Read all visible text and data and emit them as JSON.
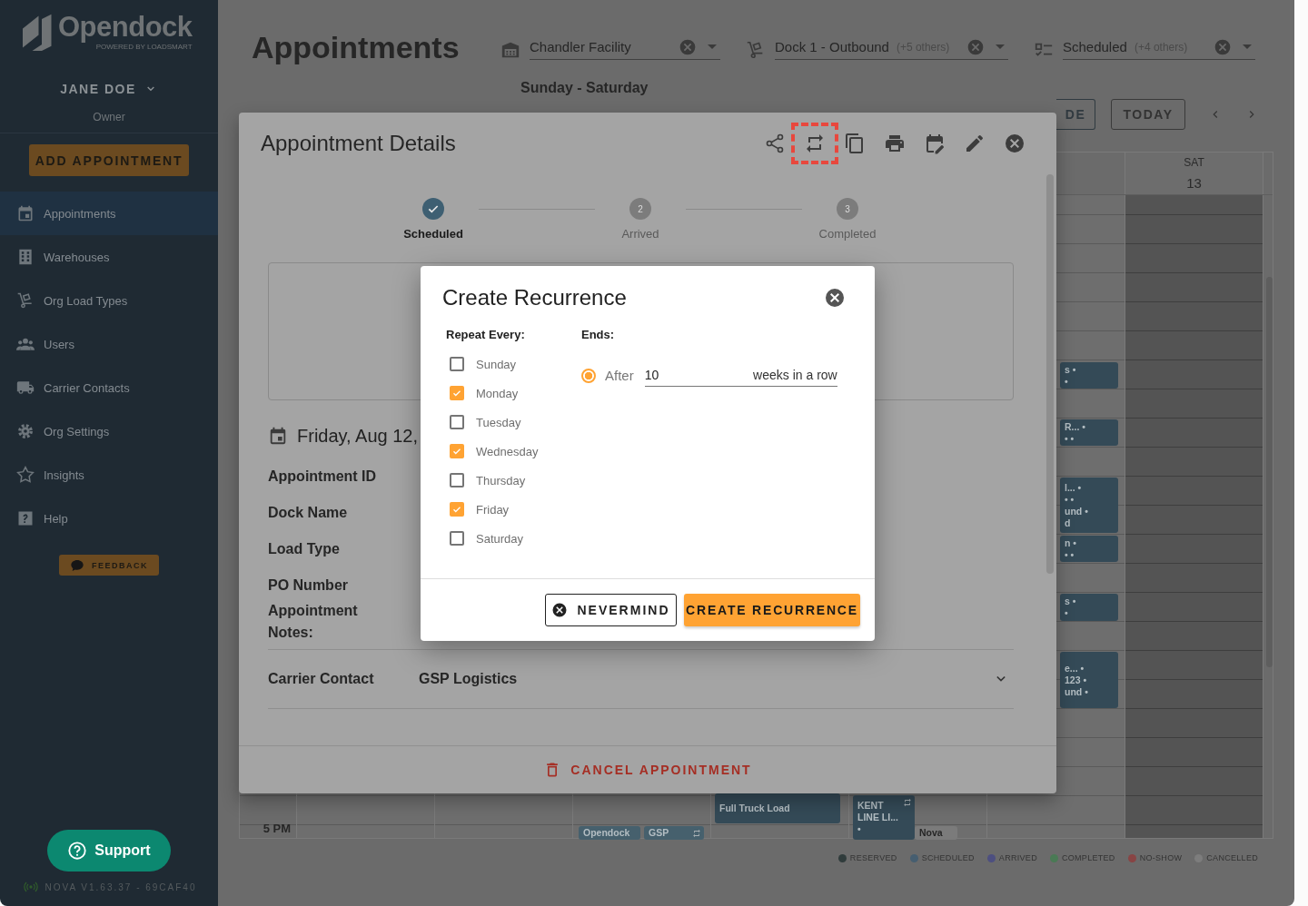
{
  "sidebar": {
    "logo": {
      "name": "Opendock",
      "tagline": "POWERED BY LOADSMART"
    },
    "user": {
      "name": "JANE DOE",
      "role": "Owner"
    },
    "add_button": "ADD APPOINTMENT",
    "nav": [
      {
        "label": "Appointments",
        "kind": "calendar",
        "selected": true
      },
      {
        "label": "Warehouses",
        "kind": "building",
        "selected": false
      },
      {
        "label": "Org Load Types",
        "kind": "dolly",
        "selected": false
      },
      {
        "label": "Users",
        "kind": "users",
        "selected": false
      },
      {
        "label": "Carrier Contacts",
        "kind": "truck",
        "selected": false
      },
      {
        "label": "Org Settings",
        "kind": "gear",
        "selected": false
      },
      {
        "label": "Insights",
        "kind": "insights",
        "selected": false
      },
      {
        "label": "Help",
        "kind": "help",
        "selected": false
      }
    ],
    "feedback": "FEEDBACK",
    "support": "Support",
    "version": "NOVA V1.63.37 - 69CAF40"
  },
  "header": {
    "title": "Appointments",
    "filters": [
      {
        "kind": "warehouse",
        "value": "Chandler Facility"
      },
      {
        "kind": "dolly",
        "value": "Dock 1 - Outbound",
        "extra": "(+5 others)"
      },
      {
        "kind": "checklist",
        "value": "Scheduled",
        "extra": "(+4 others)"
      }
    ]
  },
  "calendar": {
    "range": "Sunday - Saturday",
    "mode_button": "DE",
    "today_button": "TODAY",
    "columns": [
      {
        "day": "SAT",
        "date": "13"
      }
    ],
    "time_labels": [
      "5 PM"
    ],
    "events": [
      {
        "lines": [
          "s •",
          "•"
        ],
        "color": "#344a57"
      },
      {
        "lines": [
          "R... •",
          "•  •"
        ],
        "color": "#344a57"
      },
      {
        "lines": [
          "l... •",
          "•  •",
          "und •",
          "d"
        ],
        "color": "#344a57"
      },
      {
        "lines": [
          "n •",
          "•  •"
        ],
        "color": "#344a57"
      },
      {
        "lines": [
          "s •",
          "•"
        ],
        "color": "#344a57"
      },
      {
        "lines": [
          "e... •",
          "123 •",
          "und •"
        ],
        "color": "#344a57"
      },
      {
        "lines": [
          "Full Truck Load"
        ],
        "color": "#344a57"
      },
      {
        "lines": [
          "KENT",
          "LINE LI...",
          "•"
        ],
        "color": "#344a57",
        "recurring": true
      },
      {
        "lines": [
          "Opendock"
        ],
        "color": "#46606d"
      },
      {
        "lines": [
          "GSP"
        ],
        "color": "#46606d",
        "recurring": true
      },
      {
        "lines": [
          "Nova"
        ],
        "color": "#7b7b7b"
      }
    ],
    "legend": [
      {
        "label": "RESERVED",
        "color": "#303c3c"
      },
      {
        "label": "SCHEDULED",
        "color": "#465e70"
      },
      {
        "label": "ARRIVED",
        "color": "#4d4f80"
      },
      {
        "label": "COMPLETED",
        "color": "#4a7a55"
      },
      {
        "label": "NO-SHOW",
        "color": "#884444"
      },
      {
        "label": "CANCELLED",
        "color": "#7d7d7d"
      }
    ]
  },
  "details": {
    "title": "Appointment Details",
    "actions": [
      {
        "kind": "share",
        "highlighted": false
      },
      {
        "kind": "repeat",
        "highlighted": true
      },
      {
        "kind": "copy",
        "highlighted": false
      },
      {
        "kind": "print",
        "highlighted": false
      },
      {
        "kind": "reschedule",
        "highlighted": false
      },
      {
        "kind": "edit",
        "highlighted": false
      },
      {
        "kind": "close",
        "highlighted": false
      }
    ],
    "steps": [
      {
        "label": "Scheduled",
        "done": true
      },
      {
        "label": "Arrived",
        "number": "2",
        "done": false
      },
      {
        "label": "Completed",
        "number": "3",
        "done": false
      }
    ],
    "date": "Friday, Aug 12,",
    "fields": [
      {
        "label": "Appointment ID"
      },
      {
        "label": "Dock Name"
      },
      {
        "label": "Load Type"
      },
      {
        "label": "PO Number"
      },
      {
        "label": "Appointment Notes:"
      }
    ],
    "carrier": {
      "label": "Carrier Contact",
      "value": "GSP Logistics"
    },
    "cancel": "CANCEL APPOINTMENT"
  },
  "recurrence": {
    "title": "Create Recurrence",
    "repeat_label": "Repeat Every:",
    "days": [
      {
        "label": "Sunday",
        "checked": false
      },
      {
        "label": "Monday",
        "checked": true
      },
      {
        "label": "Tuesday",
        "checked": false
      },
      {
        "label": "Wednesday",
        "checked": true
      },
      {
        "label": "Thursday",
        "checked": false
      },
      {
        "label": "Friday",
        "checked": true
      },
      {
        "label": "Saturday",
        "checked": false
      }
    ],
    "ends_label": "Ends:",
    "end_option": {
      "label": "After",
      "selected": true,
      "value": "10",
      "suffix": "weeks in a row"
    },
    "buttons": {
      "cancel": "NEVERMIND",
      "confirm": "CREATE RECURRENCE"
    }
  }
}
